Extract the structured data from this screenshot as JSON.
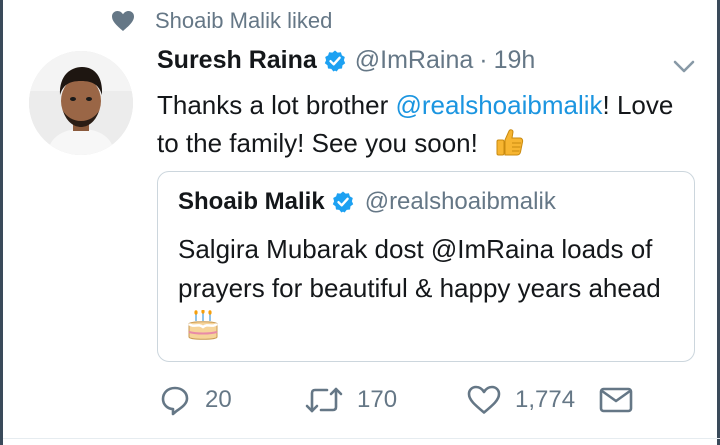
{
  "social_context": {
    "icon": "heart-icon",
    "text": "Shoaib Malik liked"
  },
  "tweet": {
    "author_name": "Suresh Raina",
    "handle": "@ImRaina",
    "separator": "·",
    "time": "19h",
    "text_before": "Thanks a lot brother ",
    "mention": "@realshoaibmalik",
    "text_after": "! Love to the family! See you soon!",
    "emoji": "thumbs-up-icon"
  },
  "quoted_tweet": {
    "author_name": "Shoaib Malik",
    "handle": "@realshoaibmalik",
    "text": "Salgira Mubarak dost @ImRaina loads of prayers for beautiful & happy years ahead",
    "emoji": "birthday-cake-icon"
  },
  "actions": {
    "replies": "20",
    "retweets": "170",
    "likes": "1,774"
  },
  "colors": {
    "text": "#14171a",
    "secondary": "#657786",
    "link": "#1b95e0",
    "verified": "#1da1f2",
    "border": "#ccd6dd"
  }
}
